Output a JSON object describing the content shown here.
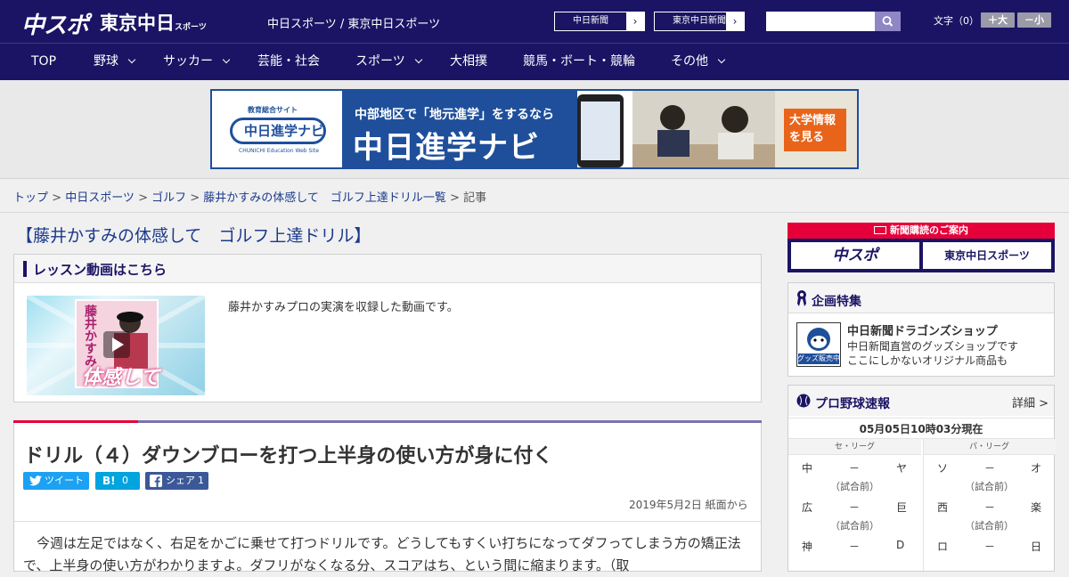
{
  "header": {
    "logo_chuspo": "中スポ",
    "logo_tokyo": "東京中日",
    "logo_tokyo_small": "スポーツ",
    "site_names": "中日スポーツ / 東京中日スポーツ",
    "paper_buttons": [
      "中日新聞",
      "東京中日新聞"
    ],
    "search_value": "",
    "font_label": "文字（0）",
    "font_bigger": "＋大",
    "font_smaller": "－小"
  },
  "nav": [
    {
      "label": "TOP",
      "has_menu": false
    },
    {
      "label": "野球",
      "has_menu": true
    },
    {
      "label": "サッカー",
      "has_menu": true
    },
    {
      "label": "芸能・社会",
      "has_menu": false
    },
    {
      "label": "スポーツ",
      "has_menu": true
    },
    {
      "label": "大相撲",
      "has_menu": false
    },
    {
      "label": "競馬・ボート・競輪",
      "has_menu": false
    },
    {
      "label": "その他",
      "has_menu": true
    }
  ],
  "banner": {
    "sub": "教育総合サイト",
    "logo": "中日進学ナビ",
    "logo_en": "CHUNICHI Education Web Site",
    "line1": "中部地区で「地元進学」をするなら",
    "line2": "中日進学ナビ",
    "cta": "大学情報を見る"
  },
  "breadcrumb": [
    "トップ",
    "中日スポーツ",
    "ゴルフ",
    "藤井かすみの体感して　ゴルフ上達ドリル一覧",
    "記事"
  ],
  "series_title": "【藤井かすみの体感して　ゴルフ上達ドリル】",
  "video": {
    "heading": "レッスン動画はこちら",
    "thumb_name": "藤井かすみ",
    "thumb_tai": "体感して",
    "description": "藤井かすみプロの実演を収録した動画です。"
  },
  "article": {
    "title": "ドリル（４）ダウンブローを打つ上半身の使い方が身に付く",
    "tweet_label": "ツイート",
    "hatena_label": "B!",
    "hatena_count": "0",
    "share_label": "シェア",
    "share_count": "1",
    "date": "2019年5月2日 紙面から",
    "body": "今週は左足ではなく、右足をかごに乗せて打つドリルです。どうしてもすくい打ちになってダフってしまう方の矯正法で、上半身の使い方がわかりますよ。ダフリがなくなる分、スコアはち、という間に縮まります。（取"
  },
  "sidebar": {
    "subscribe_head": "新聞購読のご案内",
    "subscribe_buttons": [
      "中スポ",
      "東京中日スポーツ"
    ],
    "plan_title": "企画特集",
    "plan_icon_text": "グッズ販売中",
    "plan_name": "中日新聞ドラゴンズショップ",
    "plan_desc1": "中日新聞直営のグッズショップです",
    "plan_desc2": "ここにしかないオリジナル商品も",
    "baseball_title": "プロ野球速報",
    "baseball_more": "詳細 >",
    "baseball_time": "05月05日10時03分現在",
    "central_label": "セ・リーグ",
    "pacific_label": "パ・リーグ",
    "central_games": [
      {
        "home": "中",
        "sep": "－",
        "away": "ヤ",
        "status": "（試合前）"
      },
      {
        "home": "広",
        "sep": "－",
        "away": "巨",
        "status": "（試合前）"
      },
      {
        "home": "神",
        "sep": "－",
        "away": "D",
        "status": ""
      }
    ],
    "pacific_games": [
      {
        "home": "ソ",
        "sep": "－",
        "away": "オ",
        "status": "（試合前）"
      },
      {
        "home": "西",
        "sep": "－",
        "away": "楽",
        "status": "（試合前）"
      },
      {
        "home": "ロ",
        "sep": "－",
        "away": "日",
        "status": ""
      }
    ]
  },
  "colors": {
    "brand": "#1b1464",
    "accent_red": "#e60039",
    "twitter": "#1da1f2",
    "hatena": "#00a4de",
    "facebook": "#3b5998"
  }
}
